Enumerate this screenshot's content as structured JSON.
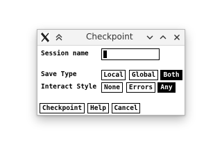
{
  "window": {
    "title": "Checkpoint"
  },
  "form": {
    "session_name_label": "Session name",
    "session_name_value": "",
    "save_type_label": "Save Type",
    "save_type_options": [
      "Local",
      "Global",
      "Both"
    ],
    "save_type_selected": "Both",
    "interact_style_label": "Interact Style",
    "interact_style_options": [
      "None",
      "Errors",
      "Any"
    ],
    "interact_style_selected": "Any"
  },
  "actions": {
    "checkpoint_label": "Checkpoint",
    "help_label": "Help",
    "cancel_label": "Cancel"
  },
  "icons": {
    "app": "x11-app-icon",
    "pin": "double-chevron-up-icon",
    "minimize": "chevron-down-icon",
    "maximize": "chevron-up-icon",
    "close": "close-icon"
  }
}
